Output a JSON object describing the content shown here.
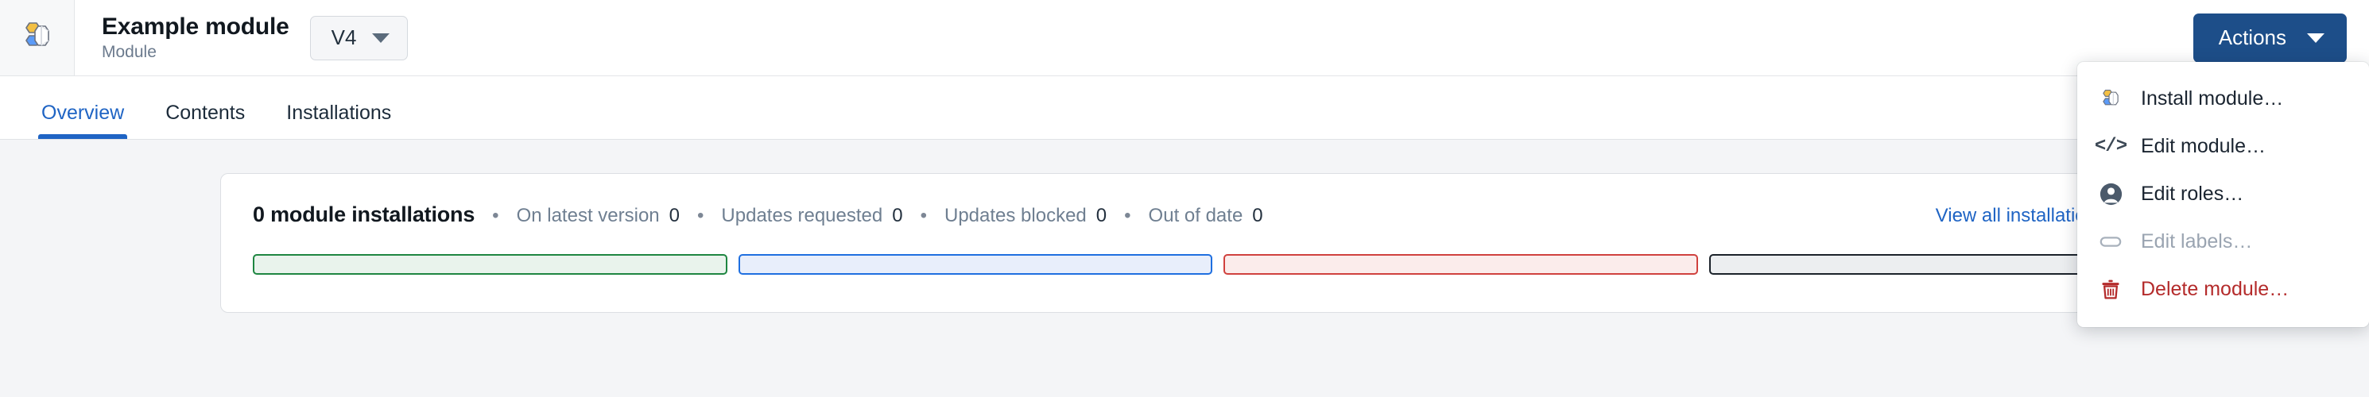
{
  "header": {
    "module_icon": "module-cube-icon",
    "title": "Example module",
    "subtitle": "Module",
    "version_label": "V4",
    "version_caret": "chevron-down-icon",
    "actions_label": "Actions",
    "actions_caret": "chevron-down-icon"
  },
  "tabs": [
    {
      "label": "Overview",
      "active": true
    },
    {
      "label": "Contents",
      "active": false
    },
    {
      "label": "Installations",
      "active": false
    }
  ],
  "overview": {
    "total_label": "0 module installations",
    "separator": "•",
    "stats": [
      {
        "label": "On latest version",
        "value": "0",
        "color": "#1e8641"
      },
      {
        "label": "Updates requested",
        "value": "0",
        "color": "#1f6fe0"
      },
      {
        "label": "Updates blocked",
        "value": "0",
        "color": "#d0413e"
      },
      {
        "label": "Out of date",
        "value": "0",
        "color": "#1b222a"
      }
    ],
    "view_all_label": "View all installations",
    "bars": [
      {
        "name": "on-latest-version",
        "width_pct": 25.6,
        "style": "bar-green"
      },
      {
        "name": "updates-requested",
        "width_pct": 25.6,
        "style": "bar-blue"
      },
      {
        "name": "updates-blocked",
        "width_pct": 25.6,
        "style": "bar-red"
      },
      {
        "name": "out-of-date",
        "width_pct": 25.6,
        "style": "bar-dark"
      }
    ]
  },
  "actions_menu": {
    "open": true,
    "items": [
      {
        "label": "Install module…",
        "icon": "module-cube-icon",
        "state": "enabled"
      },
      {
        "label": "Edit module…",
        "icon": "code-brackets-icon",
        "state": "enabled"
      },
      {
        "label": "Edit roles…",
        "icon": "person-avatar-icon",
        "state": "enabled"
      },
      {
        "label": "Edit labels…",
        "icon": "label-pill-icon",
        "state": "disabled"
      },
      {
        "label": "Delete module…",
        "icon": "trash-icon",
        "state": "danger"
      }
    ]
  },
  "colors": {
    "accent_blue": "#1f64c4",
    "button_blue": "#1d4e89",
    "danger_red": "#b42b2b",
    "page_bg": "#f4f5f7"
  }
}
